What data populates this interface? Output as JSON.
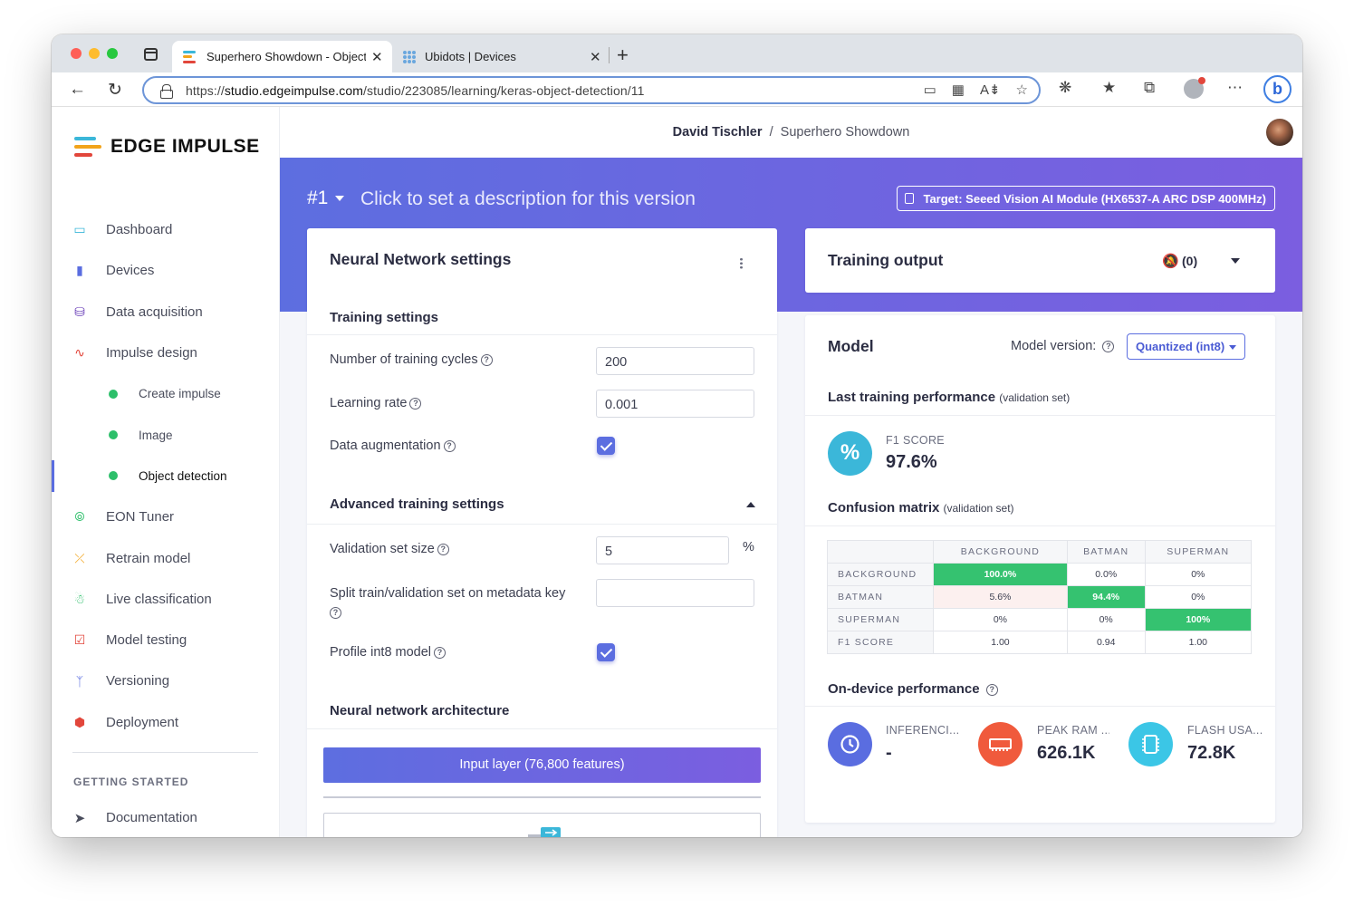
{
  "browser": {
    "tabs": [
      {
        "title": "Superhero Showdown - Object detection - Edge Impulse",
        "close": "✕"
      },
      {
        "title": "Ubidots | Devices",
        "close": "✕"
      }
    ],
    "new_tab": "+",
    "url_prefix": "https://",
    "url_host": "studio.edgeimpulse.com",
    "url_path": "/studio/223085/learning/keras-object-detection/11"
  },
  "sidebar": {
    "logo_text": "EDGE IMPULSE",
    "items": [
      {
        "label": "Dashboard",
        "icon": "monitor-icon",
        "color": "#3bb7d9"
      },
      {
        "label": "Devices",
        "icon": "chip-icon",
        "color": "#5a6de0"
      },
      {
        "label": "Data acquisition",
        "icon": "database-icon",
        "color": "#6a3fb8"
      },
      {
        "label": "Impulse design",
        "icon": "pulse-icon",
        "color": "#e2463b"
      },
      {
        "label": "Create impulse",
        "icon": "dot",
        "color": "#2dbf6a"
      },
      {
        "label": "Image",
        "icon": "dot",
        "color": "#2dbf6a"
      },
      {
        "label": "Object detection",
        "icon": "dot",
        "color": "#2dbf6a"
      },
      {
        "label": "EON Tuner",
        "icon": "compass-icon",
        "color": "#2dbf6a"
      },
      {
        "label": "Retrain model",
        "icon": "shuffle-icon",
        "color": "#f2a41b"
      },
      {
        "label": "Live classification",
        "icon": "signal-icon",
        "color": "#2dbf6a"
      },
      {
        "label": "Model testing",
        "icon": "clipboard-icon",
        "color": "#e2463b"
      },
      {
        "label": "Versioning",
        "icon": "branch-icon",
        "color": "#5a6de0"
      },
      {
        "label": "Deployment",
        "icon": "box-icon",
        "color": "#e2463b"
      }
    ],
    "section_title": "GETTING STARTED",
    "documentation": "Documentation"
  },
  "header": {
    "user": "David Tischler",
    "separator": "/",
    "project": "Superhero Showdown"
  },
  "banner": {
    "version": "#1",
    "description": "Click to set a description for this version",
    "target": "Target: Seeed Vision AI Module (HX6537-A ARC DSP 400MHz)"
  },
  "nn": {
    "title": "Neural Network settings",
    "training_settings": "Training settings",
    "cycles_label": "Number of training cycles",
    "cycles_value": "200",
    "lr_label": "Learning rate",
    "lr_value": "0.001",
    "augmentation_label": "Data augmentation",
    "advanced": "Advanced training settings",
    "val_label": "Validation set size",
    "val_value": "5",
    "val_unit": "%",
    "split_label": "Split train/validation set on metadata key",
    "split_value": "",
    "profile_label": "Profile int8 model",
    "arch_title": "Neural network architecture",
    "input_layer": "Input layer (76,800 features)",
    "help": "?"
  },
  "training_output": {
    "title": "Training output",
    "count": "(0)"
  },
  "model": {
    "title": "Model",
    "version_label": "Model version:",
    "version_value": "Quantized (int8)",
    "last_perf": "Last training performance",
    "last_perf_note": "(validation set)",
    "f1_label": "F1 SCORE",
    "f1_value": "97.6%",
    "cm_title": "Confusion matrix",
    "cm_note": "(validation set)",
    "cm_columns": [
      "BACKGROUND",
      "BATMAN",
      "SUPERMAN"
    ],
    "cm_rows": [
      {
        "label": "BACKGROUND",
        "cells": [
          "100.0%",
          "0.0%",
          "0%"
        ]
      },
      {
        "label": "BATMAN",
        "cells": [
          "5.6%",
          "94.4%",
          "0%"
        ]
      },
      {
        "label": "SUPERMAN",
        "cells": [
          "0%",
          "0%",
          "100%"
        ]
      },
      {
        "label": "F1 SCORE",
        "cells": [
          "1.00",
          "0.94",
          "1.00"
        ]
      }
    ],
    "on_device": "On-device performance",
    "inference_label": "INFERENCI...",
    "inference_value": "-",
    "ram_label": "PEAK RAM ...",
    "ram_value": "626.1K",
    "flash_label": "FLASH USA...",
    "flash_value": "72.8K",
    "percent_symbol": "%"
  },
  "colors": {
    "accent": "#5c6ee0",
    "banner_start": "#5d6ee0",
    "banner_end": "#7b5ee0",
    "positive": "#35c270"
  }
}
